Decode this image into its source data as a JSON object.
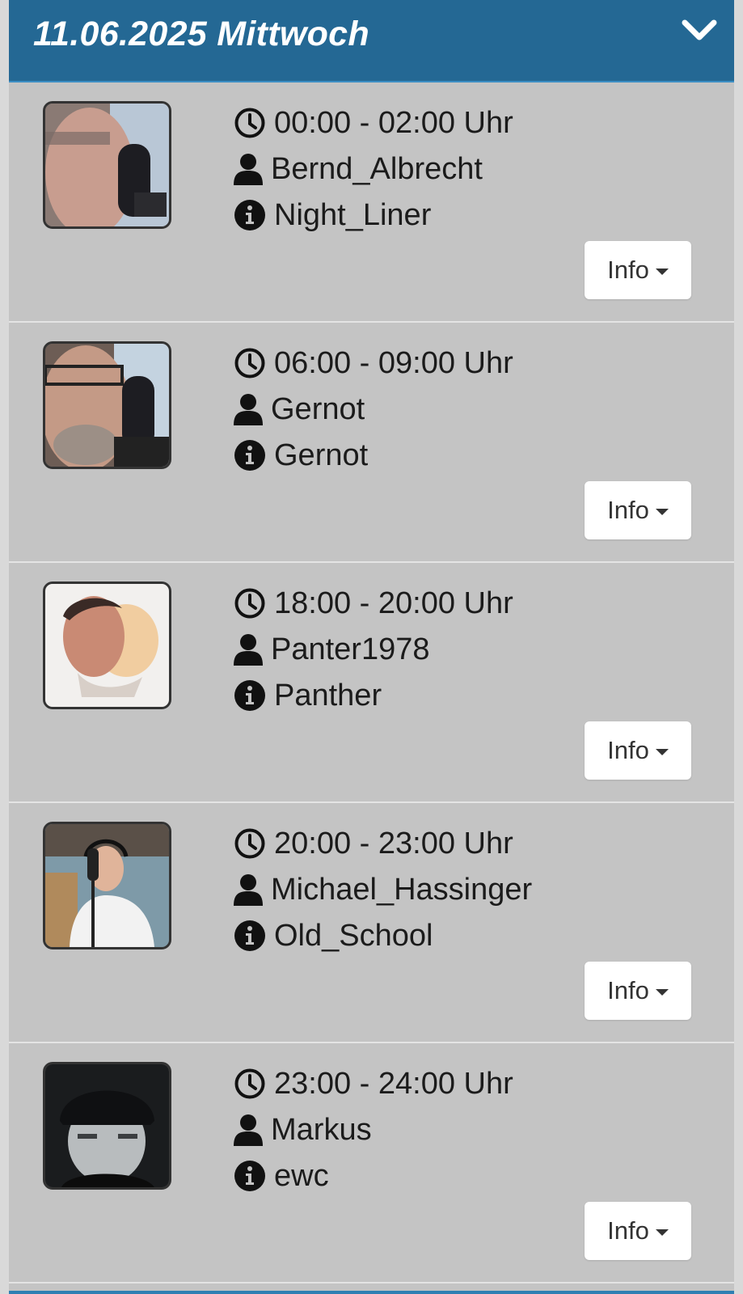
{
  "day": {
    "title": "11.06.2025 Mittwoch",
    "toggle_icon": "chevron-down-icon"
  },
  "colors": {
    "header_bg": "#246894",
    "panel_bg": "#c4c4c4",
    "button_bg": "#ffffff"
  },
  "shows": [
    {
      "time": "00:00 - 02:00 Uhr",
      "host": "Bernd_Albrecht",
      "show": "Night_Liner",
      "button": "Info"
    },
    {
      "time": "06:00 - 09:00 Uhr",
      "host": "Gernot",
      "show": "Gernot",
      "button": "Info"
    },
    {
      "time": "18:00 - 20:00 Uhr",
      "host": "Panter1978",
      "show": "Panther",
      "button": "Info"
    },
    {
      "time": "20:00 - 23:00 Uhr",
      "host": "Michael_Hassinger",
      "show": "Old_School",
      "button": "Info"
    },
    {
      "time": "23:00 - 24:00 Uhr",
      "host": "Markus",
      "show": "ewc",
      "button": "Info"
    }
  ]
}
